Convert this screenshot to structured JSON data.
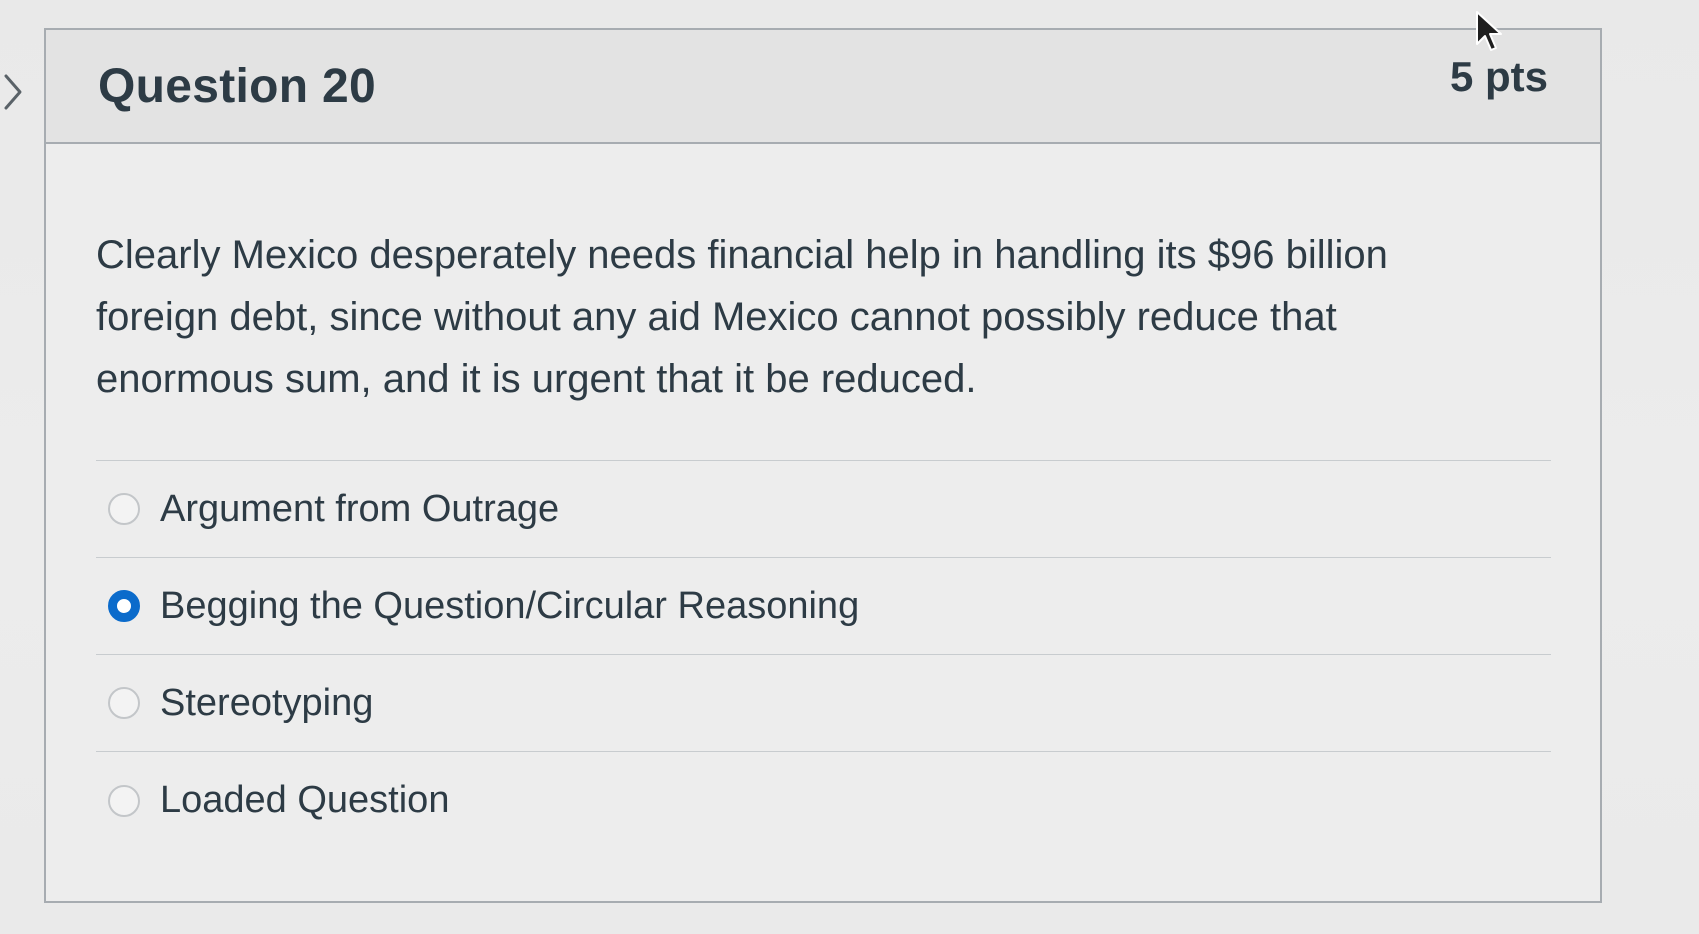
{
  "question": {
    "title": "Question 20",
    "points": "5 pts",
    "text": "Clearly Mexico desperately needs financial help in handling its $96 billion foreign debt, since without any aid Mexico cannot possibly reduce that enormous sum, and it is urgent that it be reduced."
  },
  "answers": [
    {
      "label": "Argument from Outrage",
      "selected": false
    },
    {
      "label": "Begging the Question/Circular Reasoning",
      "selected": true
    },
    {
      "label": "Stereotyping",
      "selected": false
    },
    {
      "label": "Loaded Question",
      "selected": false
    }
  ],
  "colors": {
    "selected_radio": "#0b6bcb",
    "text": "#2d3b45",
    "border": "#a7acb1"
  },
  "icons": {
    "side_toggle": "chevron-right-icon",
    "cursor": "mouse-pointer-icon"
  }
}
